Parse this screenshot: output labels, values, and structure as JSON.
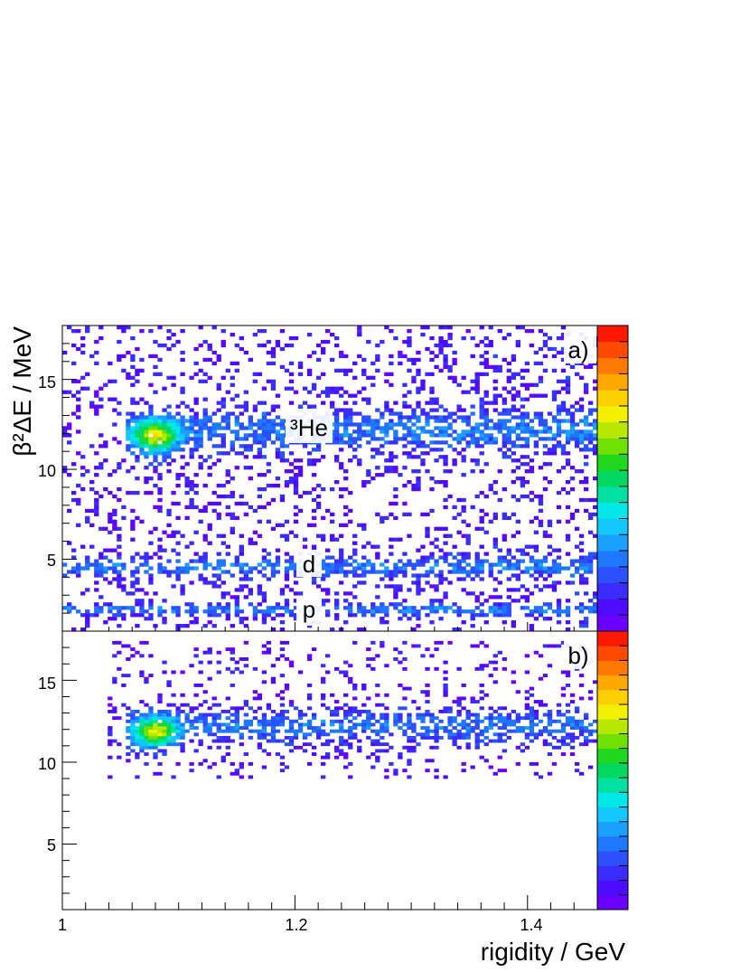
{
  "chart_data": [
    {
      "type": "heatmap",
      "panel_label": "a)",
      "ylabel": "β²ΔE / MeV",
      "xlim": [
        1.0,
        1.46
      ],
      "ylim": [
        1.0,
        18.0
      ],
      "yticks": [
        5,
        10,
        15
      ],
      "annotations": [
        {
          "text": "³He",
          "x": 1.205,
          "y": 12.3
        },
        {
          "text": "d",
          "x": 1.208,
          "y": 4.7
        },
        {
          "text": "p",
          "x": 1.208,
          "y": 1.3
        }
      ],
      "bands": [
        {
          "label": "³He",
          "y_center": 12.2,
          "y_half_width": 1.0,
          "x_start": 1.055,
          "x_end": 1.46,
          "peak": {
            "x": 1.08,
            "y": 11.8
          }
        },
        {
          "label": "d",
          "y_center": 4.6,
          "y_half_width": 0.5,
          "x_start": 1.0,
          "x_end": 1.46
        },
        {
          "label": "p",
          "y_center": 2.2,
          "y_half_width": 0.3,
          "x_start": 1.0,
          "x_end": 1.46
        }
      ],
      "grid": false
    },
    {
      "type": "heatmap",
      "panel_label": "b)",
      "xlabel": "rigidity / GeV",
      "xlim": [
        1.0,
        1.46
      ],
      "ylim": [
        1.0,
        18.0
      ],
      "xticks": [
        1,
        1.2,
        1.4
      ],
      "yticks": [
        5,
        10,
        15
      ],
      "bands": [
        {
          "label": "³He",
          "y_center": 12.2,
          "y_half_width": 1.0,
          "x_start": 1.055,
          "x_end": 1.46,
          "peak": {
            "x": 1.08,
            "y": 11.8
          }
        }
      ],
      "grid": false
    }
  ],
  "palette": [
    "#6a00ff",
    "#4d0cff",
    "#3a2cff",
    "#2b50ff",
    "#1e78ff",
    "#1aa0ff",
    "#14c8ff",
    "#00e8e8",
    "#00e0a0",
    "#00d860",
    "#20d820",
    "#70e000",
    "#b8e800",
    "#f0f000",
    "#ffd000",
    "#ffa800",
    "#ff7800",
    "#ff4800",
    "#ff1800"
  ]
}
